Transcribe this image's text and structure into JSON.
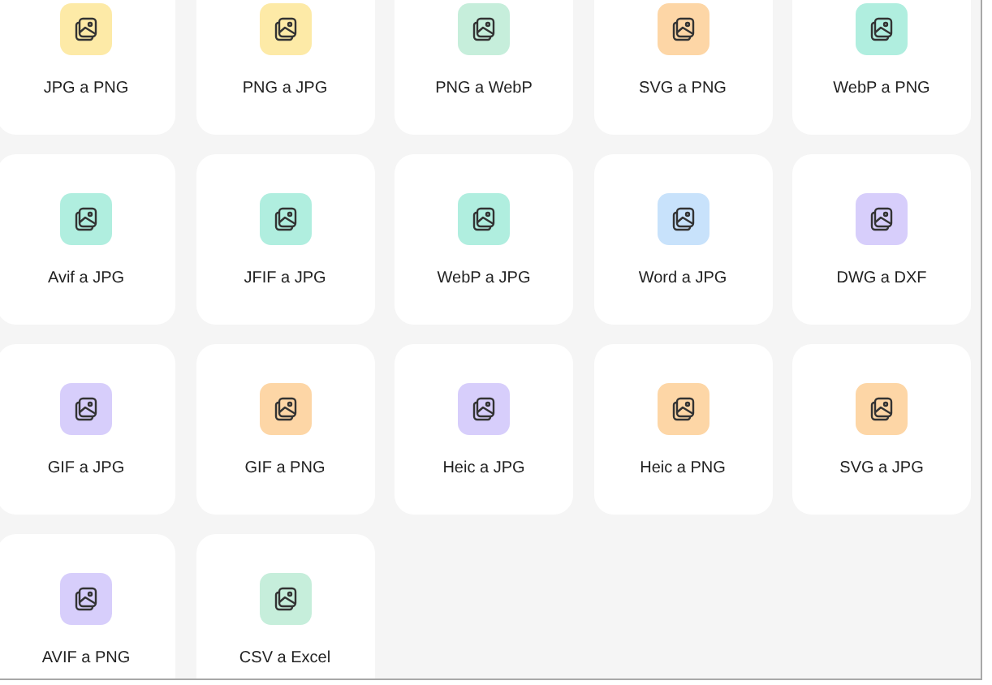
{
  "tools": [
    {
      "label": "JPG a PNG",
      "color": "#fdeaa7"
    },
    {
      "label": "PNG a JPG",
      "color": "#fdeaa7"
    },
    {
      "label": "PNG a WebP",
      "color": "#c6eedb"
    },
    {
      "label": "SVG a PNG",
      "color": "#fdd6a6"
    },
    {
      "label": "WebP a PNG",
      "color": "#b0eedf"
    },
    {
      "label": "Avif a JPG",
      "color": "#b0eedf"
    },
    {
      "label": "JFIF a JPG",
      "color": "#b0eedf"
    },
    {
      "label": "WebP a JPG",
      "color": "#b0eedf"
    },
    {
      "label": "Word a JPG",
      "color": "#c8e2fb"
    },
    {
      "label": "DWG a DXF",
      "color": "#d7cefb"
    },
    {
      "label": "GIF a JPG",
      "color": "#d7cefb"
    },
    {
      "label": "GIF a PNG",
      "color": "#fdd6a6"
    },
    {
      "label": "Heic a JPG",
      "color": "#d7cefb"
    },
    {
      "label": "Heic a PNG",
      "color": "#fdd6a6"
    },
    {
      "label": "SVG a JPG",
      "color": "#fdd6a6"
    },
    {
      "label": "AVIF a PNG",
      "color": "#d7cefb"
    },
    {
      "label": "CSV a Excel",
      "color": "#c6eedb"
    }
  ]
}
